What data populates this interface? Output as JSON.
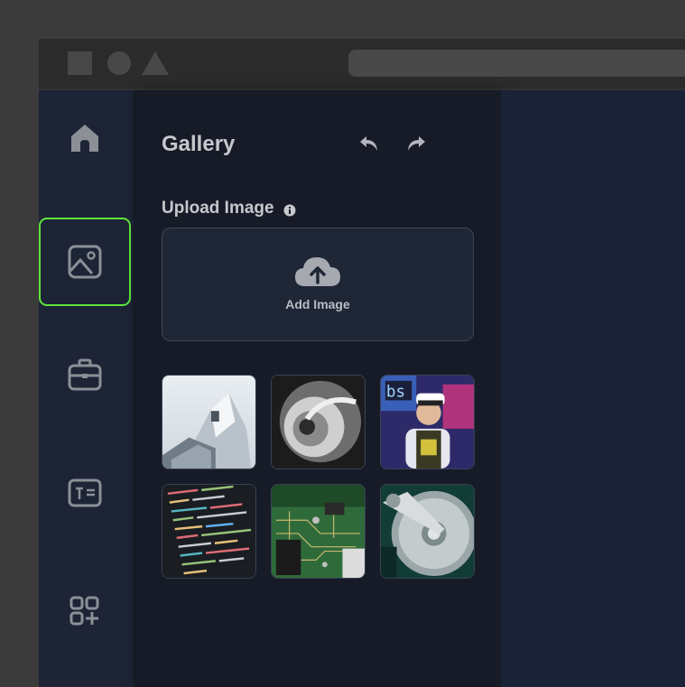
{
  "window": {
    "titlebar_shapes": [
      "square-shape",
      "circle-shape",
      "triangle-shape"
    ]
  },
  "sidebar": {
    "items": [
      {
        "name": "home",
        "icon": "home-icon",
        "active": false
      },
      {
        "name": "gallery",
        "icon": "image-icon",
        "active": true
      },
      {
        "name": "briefcase",
        "icon": "briefcase-icon",
        "active": false
      },
      {
        "name": "text",
        "icon": "text-box-icon",
        "active": false
      },
      {
        "name": "apps",
        "icon": "apps-add-icon",
        "active": false
      }
    ],
    "active_color": "#5fe53a"
  },
  "panel": {
    "title": "Gallery",
    "undo_icon": "undo-icon",
    "redo_icon": "redo-icon",
    "upload_label": "Upload Image",
    "info_icon": "info-icon",
    "add_image_label": "Add Image",
    "upload_icon": "cloud-upload-icon",
    "thumbnails": [
      {
        "subject": "modern building"
      },
      {
        "subject": "spiral staircase"
      },
      {
        "subject": "person with VR headset"
      },
      {
        "subject": "code on screen"
      },
      {
        "subject": "circuit board"
      },
      {
        "subject": "hard disk drive"
      }
    ]
  }
}
